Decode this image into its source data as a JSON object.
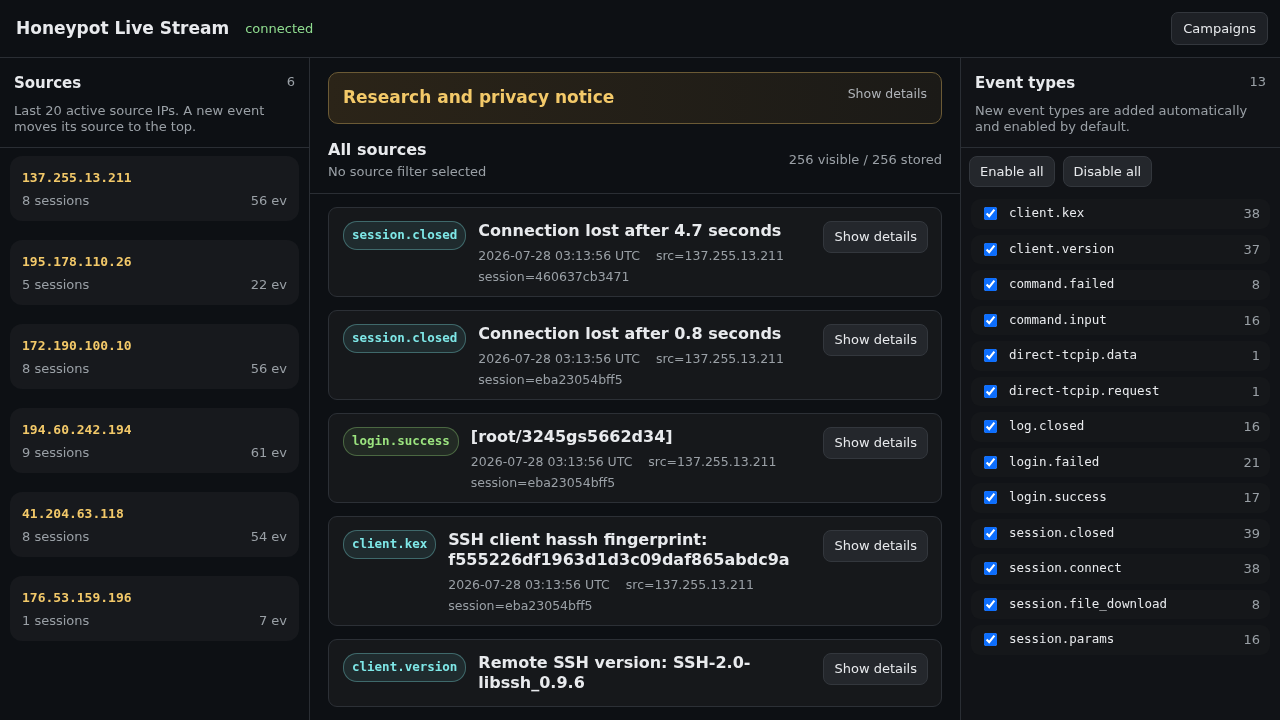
{
  "header": {
    "title": "Honeypot Live Stream",
    "status": "connected",
    "button": "Campaigns"
  },
  "sources": {
    "title": "Sources",
    "count": "6",
    "description": "Last 20 active source IPs. A new event moves its source to the top.",
    "items": [
      {
        "ip": "137.255.13.211",
        "sessions": "8 sessions",
        "events": "56 ev"
      },
      {
        "ip": "195.178.110.26",
        "sessions": "5 sessions",
        "events": "22 ev"
      },
      {
        "ip": "172.190.100.10",
        "sessions": "8 sessions",
        "events": "56 ev"
      },
      {
        "ip": "194.60.242.194",
        "sessions": "9 sessions",
        "events": "61 ev"
      },
      {
        "ip": "41.204.63.118",
        "sessions": "8 sessions",
        "events": "54 ev"
      },
      {
        "ip": "176.53.159.196",
        "sessions": "1 sessions",
        "events": "7 ev"
      }
    ]
  },
  "notice": {
    "title": "Research and privacy notice",
    "toggle": "Show details"
  },
  "feed": {
    "title": "All sources",
    "subtitle": "No source filter selected",
    "count": "256 visible / 256 stored",
    "events": [
      {
        "type": "session.closed",
        "color": "#7ee7e7",
        "title": "Connection lost after 4.7 seconds",
        "time": "2026-07-28 03:13:56 UTC",
        "src": "src=137.255.13.211",
        "session": "session=460637cb3471",
        "button": "Show details"
      },
      {
        "type": "session.closed",
        "color": "#7ee7e7",
        "title": "Connection lost after 0.8 seconds",
        "time": "2026-07-28 03:13:56 UTC",
        "src": "src=137.255.13.211",
        "session": "session=eba23054bff5",
        "button": "Show details"
      },
      {
        "type": "login.success",
        "color": "#9be37f",
        "title": "[root/3245gs5662d34]",
        "time": "2026-07-28 03:13:56 UTC",
        "src": "src=137.255.13.211",
        "session": "session=eba23054bff5",
        "button": "Show details"
      },
      {
        "type": "client.kex",
        "color": "#7ee7e7",
        "title": "SSH client hassh fingerprint: f555226df1963d1d3c09daf865abdc9a",
        "time": "2026-07-28 03:13:56 UTC",
        "src": "src=137.255.13.211",
        "session": "session=eba23054bff5",
        "button": "Show details"
      },
      {
        "type": "client.version",
        "color": "#7ee7e7",
        "title": "Remote SSH version: SSH-2.0-libssh_0.9.6",
        "button": "Show details"
      }
    ]
  },
  "event_types": {
    "title": "Event types",
    "count": "13",
    "description": "New event types are added automatically and enabled by default.",
    "buttons": [
      "Enable all",
      "Disable all"
    ],
    "items": [
      {
        "name": "client.kex",
        "count": "38",
        "checked": true
      },
      {
        "name": "client.version",
        "count": "37",
        "checked": true
      },
      {
        "name": "command.failed",
        "count": "8",
        "checked": true
      },
      {
        "name": "command.input",
        "count": "16",
        "checked": true
      },
      {
        "name": "direct-tcpip.data",
        "count": "1",
        "checked": true
      },
      {
        "name": "direct-tcpip.request",
        "count": "1",
        "checked": true
      },
      {
        "name": "log.closed",
        "count": "16",
        "checked": true
      },
      {
        "name": "login.failed",
        "count": "21",
        "checked": true
      },
      {
        "name": "login.success",
        "count": "17",
        "checked": true
      },
      {
        "name": "session.closed",
        "count": "39",
        "checked": true
      },
      {
        "name": "session.connect",
        "count": "38",
        "checked": true
      },
      {
        "name": "session.file_download",
        "count": "8",
        "checked": true
      },
      {
        "name": "session.params",
        "count": "16",
        "checked": true
      }
    ]
  }
}
